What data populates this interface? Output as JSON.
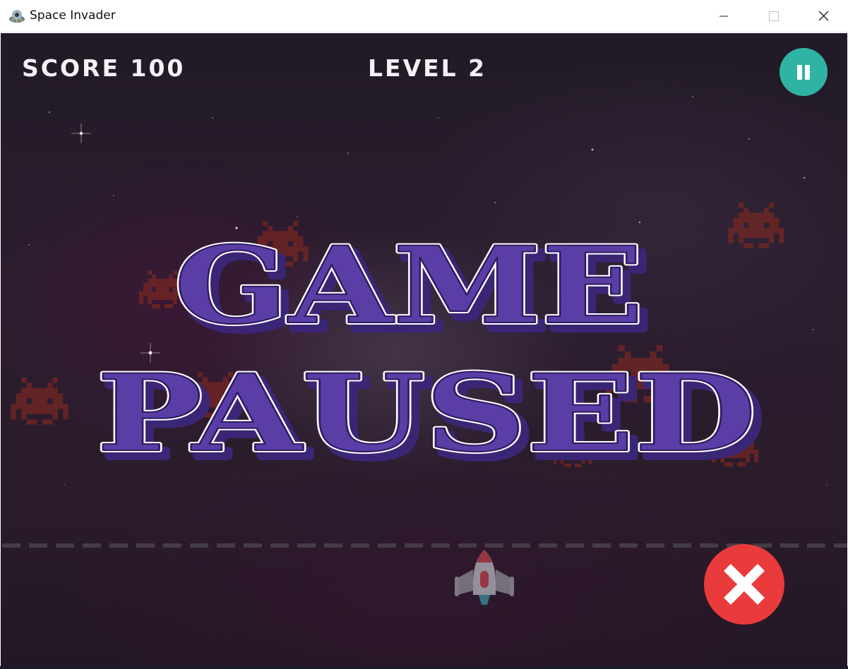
{
  "window": {
    "title": "Space Invader",
    "icon": "ufo-icon",
    "controls": [
      "minimize-icon",
      "maximize-icon",
      "close-icon"
    ]
  },
  "hud": {
    "score_label": "SCORE 100",
    "level_label": "LEVEL 2",
    "pause_icon": "pause-icon"
  },
  "overlay": {
    "line1": "GAME",
    "line2": "PAUSED"
  },
  "actions": {
    "close_icon": "close-x-icon"
  },
  "colors": {
    "title_fill": "#5a3ea6",
    "title_outline": "#ffffff",
    "pause_button": "#2fb3a4",
    "close_button": "#e93b3b",
    "invader": "#8f2a1e"
  }
}
